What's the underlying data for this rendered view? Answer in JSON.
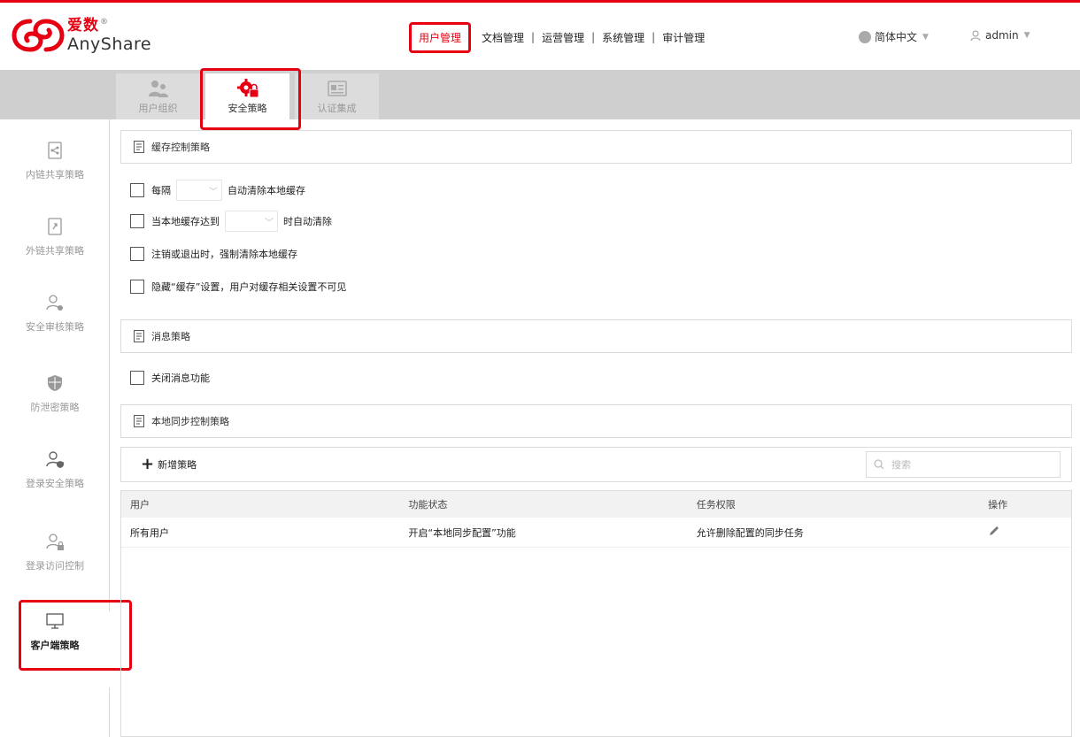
{
  "brand": {
    "name_cn": "爱数",
    "name_en": "AnyShare",
    "accent": "#e60012"
  },
  "topnav": {
    "items": [
      {
        "label": "用户管理",
        "active": true
      },
      {
        "label": "文档管理",
        "active": false
      },
      {
        "label": "运营管理",
        "active": false
      },
      {
        "label": "系统管理",
        "active": false
      },
      {
        "label": "审计管理",
        "active": false
      }
    ],
    "separator": "|",
    "language": "简体中文",
    "user": "admin"
  },
  "tabs": [
    {
      "label": "用户组织",
      "icon": "users-icon",
      "active": false
    },
    {
      "label": "安全策略",
      "icon": "gear-lock-icon",
      "active": true
    },
    {
      "label": "认证集成",
      "icon": "id-card-icon",
      "active": false
    }
  ],
  "sidebar": {
    "items": [
      {
        "label": "内链共享策略",
        "icon": "inner-link-icon",
        "active": false
      },
      {
        "label": "外链共享策略",
        "icon": "outer-link-icon",
        "active": false
      },
      {
        "label": "安全审核策略",
        "icon": "audit-user-icon",
        "active": false
      },
      {
        "label": "防泄密策略",
        "icon": "shield-icon",
        "active": false
      },
      {
        "label": "登录安全策略",
        "icon": "login-shield-icon",
        "active": false
      },
      {
        "label": "登录访问控制",
        "icon": "user-lock-icon",
        "active": false
      },
      {
        "label": "客户端策略",
        "icon": "monitor-icon",
        "active": true
      }
    ]
  },
  "cache_section": {
    "title": "缓存控制策略",
    "options": [
      {
        "prefix": "每隔",
        "select_value": "",
        "suffix": "自动清除本地缓存",
        "checked": false
      },
      {
        "prefix": "当本地缓存达到",
        "select_value": "",
        "suffix": "时自动清除",
        "checked": false
      },
      {
        "label": "注销或退出时，强制清除本地缓存",
        "checked": false
      },
      {
        "label": "隐藏“缓存”设置，用户对缓存相关设置不可见",
        "checked": false
      }
    ]
  },
  "message_section": {
    "title": "消息策略",
    "option": {
      "label": "关闭消息功能",
      "checked": false
    }
  },
  "sync_section": {
    "title": "本地同步控制策略",
    "add_label": "新增策略",
    "search_placeholder": "搜索",
    "columns": [
      "用户",
      "功能状态",
      "任务权限",
      "操作"
    ],
    "rows": [
      {
        "user": "所有用户",
        "status": "开启“本地同步配置”功能",
        "permission": "允许删除配置的同步任务",
        "action_icon": "pencil-icon"
      }
    ]
  }
}
